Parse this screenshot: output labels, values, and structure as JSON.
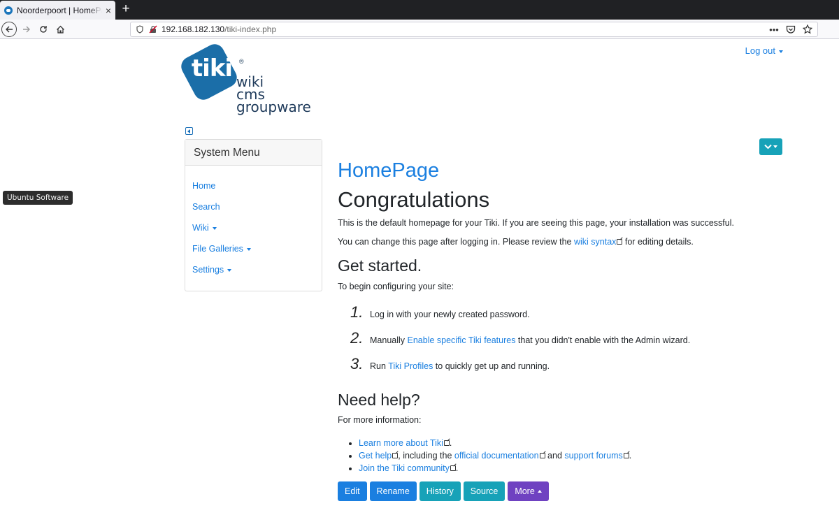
{
  "browser": {
    "tab_title": "Noorderpoort | HomePage",
    "tab_close": "×",
    "new_tab": "+",
    "url_host": "192.168.182.130",
    "url_path": "/tiki-index.php",
    "url_actions_more": "•••"
  },
  "tooltip": "Ubuntu Software",
  "logo": {
    "mark_text": "tiki",
    "reg": "®",
    "line1": "wiki",
    "line2": "cms",
    "line3": "groupware"
  },
  "header": {
    "logout": "Log out"
  },
  "system_menu": {
    "title": "System Menu",
    "items": [
      {
        "label": "Home",
        "dropdown": false
      },
      {
        "label": "Search",
        "dropdown": false
      },
      {
        "label": "Wiki",
        "dropdown": true
      },
      {
        "label": "File Galleries",
        "dropdown": true
      },
      {
        "label": "Settings",
        "dropdown": true
      }
    ]
  },
  "content": {
    "page_title": "HomePage",
    "heading": "Congratulations",
    "intro": "This is the default homepage for your Tiki. If you are seeing this page, your installation was successful.",
    "change_text_before": "You can change this page after logging in. Please review the ",
    "change_link": "wiki syntax",
    "change_text_after": " for editing details.",
    "get_started_heading": "Get started.",
    "get_started_text": "To begin configuring your site:",
    "steps": [
      {
        "num": "1.",
        "before": "Log in with your newly created password.",
        "link": "",
        "after": ""
      },
      {
        "num": "2.",
        "before": "Manually ",
        "link": "Enable specific Tiki features",
        "after": " that you didn't enable with the Admin wizard."
      },
      {
        "num": "3.",
        "before": "Run ",
        "link": "Tiki Profiles",
        "after": " to quickly get up and running."
      }
    ],
    "help_heading": "Need help?",
    "help_text": "For more information:",
    "bullet1_link": "Learn more about Tiki",
    "bullet2_link1": "Get help",
    "bullet2_text1": ", including the ",
    "bullet2_link2": "official documentation",
    "bullet2_text2": " and ",
    "bullet2_link3": "support forums",
    "bullet2_text3": ".",
    "bullet3_link": "Join the Tiki community",
    "period": "."
  },
  "buttons": {
    "edit": "Edit",
    "rename": "Rename",
    "history": "History",
    "source": "Source",
    "more": "More"
  },
  "colors": {
    "link": "#1a7fe0",
    "teal": "#17a2b8",
    "purple": "#6f42c1"
  }
}
